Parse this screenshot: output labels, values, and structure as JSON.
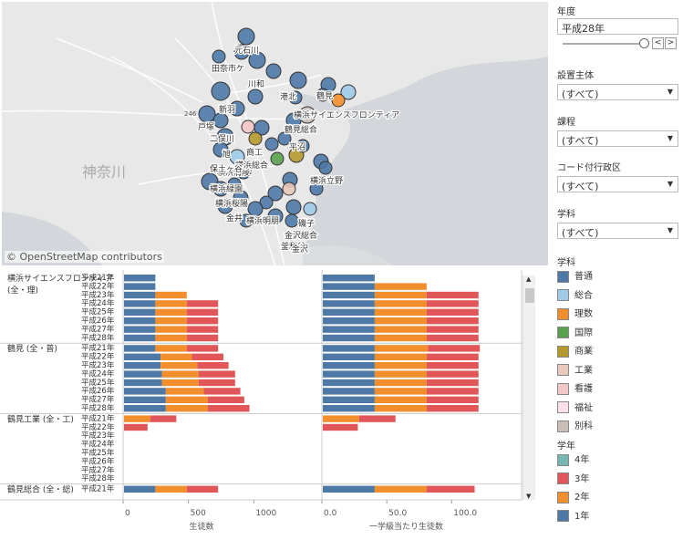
{
  "map": {
    "credit": "© OpenStreetMap contributors",
    "region_label": "神奈川",
    "road_number": "246",
    "place_labels": [
      "元石川",
      "田奈",
      "市ケ",
      "川和",
      "横浜サイエンスフロンティア",
      "鶴見",
      "鶴見総合",
      "港北",
      "新羽",
      "二俣川",
      "旭",
      "商工",
      "平沼",
      "横浜清陵",
      "横浜総合",
      "横浜立野",
      "横浜緑園",
      "横浜桜陽",
      "金井",
      "横浜明朋",
      "磯子",
      "金沢総合",
      "釜利谷",
      "金沢",
      "戸塚",
      "保土ヶ谷"
    ]
  },
  "filters": {
    "year": {
      "label": "年度",
      "value": "平成28年"
    },
    "dropdowns": [
      {
        "label": "設置主体",
        "value": "(すべて)"
      },
      {
        "label": "課程",
        "value": "(すべて)"
      },
      {
        "label": "コード付行政区",
        "value": "(すべて)"
      },
      {
        "label": "学科",
        "value": "(すべて)"
      }
    ]
  },
  "legend_dept": {
    "title": "学科",
    "items": [
      {
        "label": "普通",
        "color": "#4e79a7"
      },
      {
        "label": "総合",
        "color": "#a0cbe8"
      },
      {
        "label": "理数",
        "color": "#f28e2b"
      },
      {
        "label": "国際",
        "color": "#59a14f"
      },
      {
        "label": "商業",
        "color": "#b6992d"
      },
      {
        "label": "工業",
        "color": "#e8c8b8"
      },
      {
        "label": "看護",
        "color": "#f4c7c7"
      },
      {
        "label": "福祉",
        "color": "#fde0ea"
      },
      {
        "label": "別科",
        "color": "#c9bdb6"
      }
    ]
  },
  "legend_grade": {
    "title": "学年",
    "items": [
      {
        "label": "4年",
        "color": "#76b7b2"
      },
      {
        "label": "3年",
        "color": "#e15759"
      },
      {
        "label": "2年",
        "color": "#f28e2b"
      },
      {
        "label": "1年",
        "color": "#4e79a7"
      }
    ]
  },
  "chart_data": {
    "type": "bar",
    "stacked": true,
    "orientation": "horizontal",
    "groups": [
      {
        "name": "横浜サイエンスフロンティア (全・理)",
        "rows": [
          "平成21年",
          "平成22年",
          "平成23年",
          "平成24年",
          "平成25年",
          "平成26年",
          "平成27年",
          "平成28年"
        ]
      },
      {
        "name": "鶴見 (全・普)",
        "rows": [
          "平成21年",
          "平成22年",
          "平成23年",
          "平成24年",
          "平成25年",
          "平成26年",
          "平成27年",
          "平成28年"
        ]
      },
      {
        "name": "鶴見工業 (全・工)",
        "rows": [
          "平成21年",
          "平成22年",
          "平成23年",
          "平成24年",
          "平成25年",
          "平成26年",
          "平成27年",
          "平成28年"
        ]
      },
      {
        "name": "鶴見総合 (全・総)",
        "rows": [
          "平成21年"
        ]
      }
    ],
    "series": [
      "1年",
      "2年",
      "3年"
    ],
    "panels": [
      {
        "xlabel": "生徒数",
        "xlim": [
          0,
          1200
        ],
        "ticks": [
          "0",
          "500",
          "1000"
        ],
        "values": [
          [
            [
              240,
              0,
              0
            ],
            [
              240,
              0,
              0
            ],
            [
              240,
              240,
              0
            ],
            [
              240,
              240,
              240
            ],
            [
              240,
              240,
              240
            ],
            [
              240,
              240,
              240
            ],
            [
              240,
              240,
              240
            ],
            [
              240,
              240,
              240
            ]
          ],
          [
            [
              240,
              240,
              240
            ],
            [
              280,
              240,
              240
            ],
            [
              280,
              280,
              240
            ],
            [
              290,
              280,
              280
            ],
            [
              290,
              280,
              280
            ],
            [
              320,
              290,
              280
            ],
            [
              320,
              320,
              280
            ],
            [
              320,
              320,
              320
            ]
          ],
          [
            [
              0,
              200,
              200
            ],
            [
              0,
              0,
              180
            ],
            [
              0,
              0,
              0
            ],
            [
              0,
              0,
              0
            ],
            [
              0,
              0,
              0
            ],
            [
              0,
              0,
              0
            ],
            [
              0,
              0,
              0
            ],
            [
              0,
              0,
              0
            ]
          ],
          [
            [
              240,
              240,
              240
            ]
          ]
        ]
      },
      {
        "xlabel": "一学級当たり生徒数",
        "xlim": [
          0,
          130
        ],
        "ticks": [
          "0.0",
          "50.0",
          "100.0"
        ],
        "values": [
          [
            [
              40,
              0,
              0
            ],
            [
              40,
              40,
              0
            ],
            [
              40,
              40,
              40
            ],
            [
              40,
              40,
              40
            ],
            [
              40,
              40,
              40
            ],
            [
              40,
              40,
              40
            ],
            [
              40,
              40,
              40
            ],
            [
              40,
              40,
              40
            ]
          ],
          [
            [
              40,
              41,
              40
            ],
            [
              40,
              40,
              40
            ],
            [
              40,
              40,
              40
            ],
            [
              40,
              40,
              40
            ],
            [
              40,
              40,
              40
            ],
            [
              40,
              40,
              40
            ],
            [
              40,
              40,
              40
            ],
            [
              40,
              40,
              40
            ]
          ],
          [
            [
              0,
              28,
              28
            ],
            [
              0,
              0,
              27
            ],
            [
              0,
              0,
              0
            ],
            [
              0,
              0,
              0
            ],
            [
              0,
              0,
              0
            ],
            [
              0,
              0,
              0
            ],
            [
              0,
              0,
              0
            ],
            [
              0,
              0,
              0
            ]
          ],
          [
            [
              40,
              40,
              37
            ]
          ]
        ]
      }
    ]
  }
}
